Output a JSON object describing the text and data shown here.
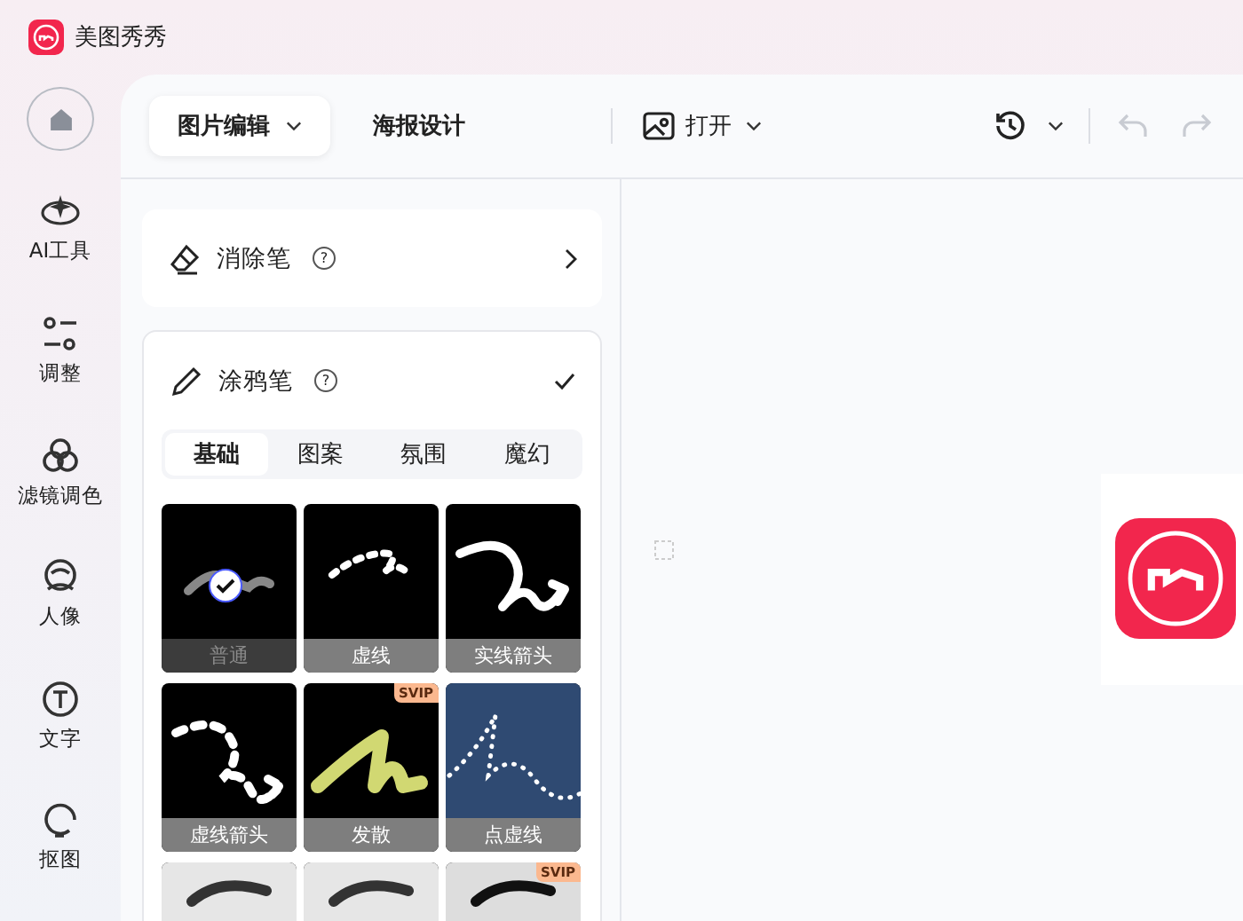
{
  "app": {
    "title": "美图秀秀"
  },
  "sidebar": {
    "items": [
      {
        "kind": "ai",
        "label": "AI工具"
      },
      {
        "kind": "adjust",
        "label": "调整"
      },
      {
        "kind": "filter",
        "label": "滤镜调色"
      },
      {
        "kind": "portrait",
        "label": "人像"
      },
      {
        "kind": "text",
        "label": "文字"
      },
      {
        "kind": "cutout",
        "label": "抠图"
      }
    ]
  },
  "toolbar": {
    "tabs": [
      {
        "label": "图片编辑",
        "selected": true,
        "dropdown": true
      },
      {
        "label": "海报设计",
        "selected": false,
        "dropdown": false
      }
    ],
    "open_label": "打开"
  },
  "eraser": {
    "title": "消除笔",
    "help": "?"
  },
  "doodle": {
    "title": "涂鸦笔",
    "help": "?",
    "segments": [
      {
        "label": "基础",
        "selected": true
      },
      {
        "label": "图案",
        "selected": false
      },
      {
        "label": "氛围",
        "selected": false
      },
      {
        "label": "魔幻",
        "selected": false
      }
    ],
    "brushes": [
      {
        "kind": "solid",
        "label": "普通",
        "selected": true
      },
      {
        "kind": "dashed",
        "label": "虚线",
        "selected": false
      },
      {
        "kind": "arrow",
        "label": "实线箭头",
        "selected": false
      },
      {
        "kind": "dashed-arrow",
        "label": "虚线箭头",
        "selected": false
      },
      {
        "kind": "glow",
        "label": "发散",
        "selected": false,
        "badge": "SVIP"
      },
      {
        "kind": "dotted",
        "label": "点虚线",
        "selected": false
      },
      {
        "kind": "paper"
      },
      {
        "kind": "paper-light"
      },
      {
        "kind": "paper-dark",
        "badge": "SVIP"
      }
    ]
  }
}
